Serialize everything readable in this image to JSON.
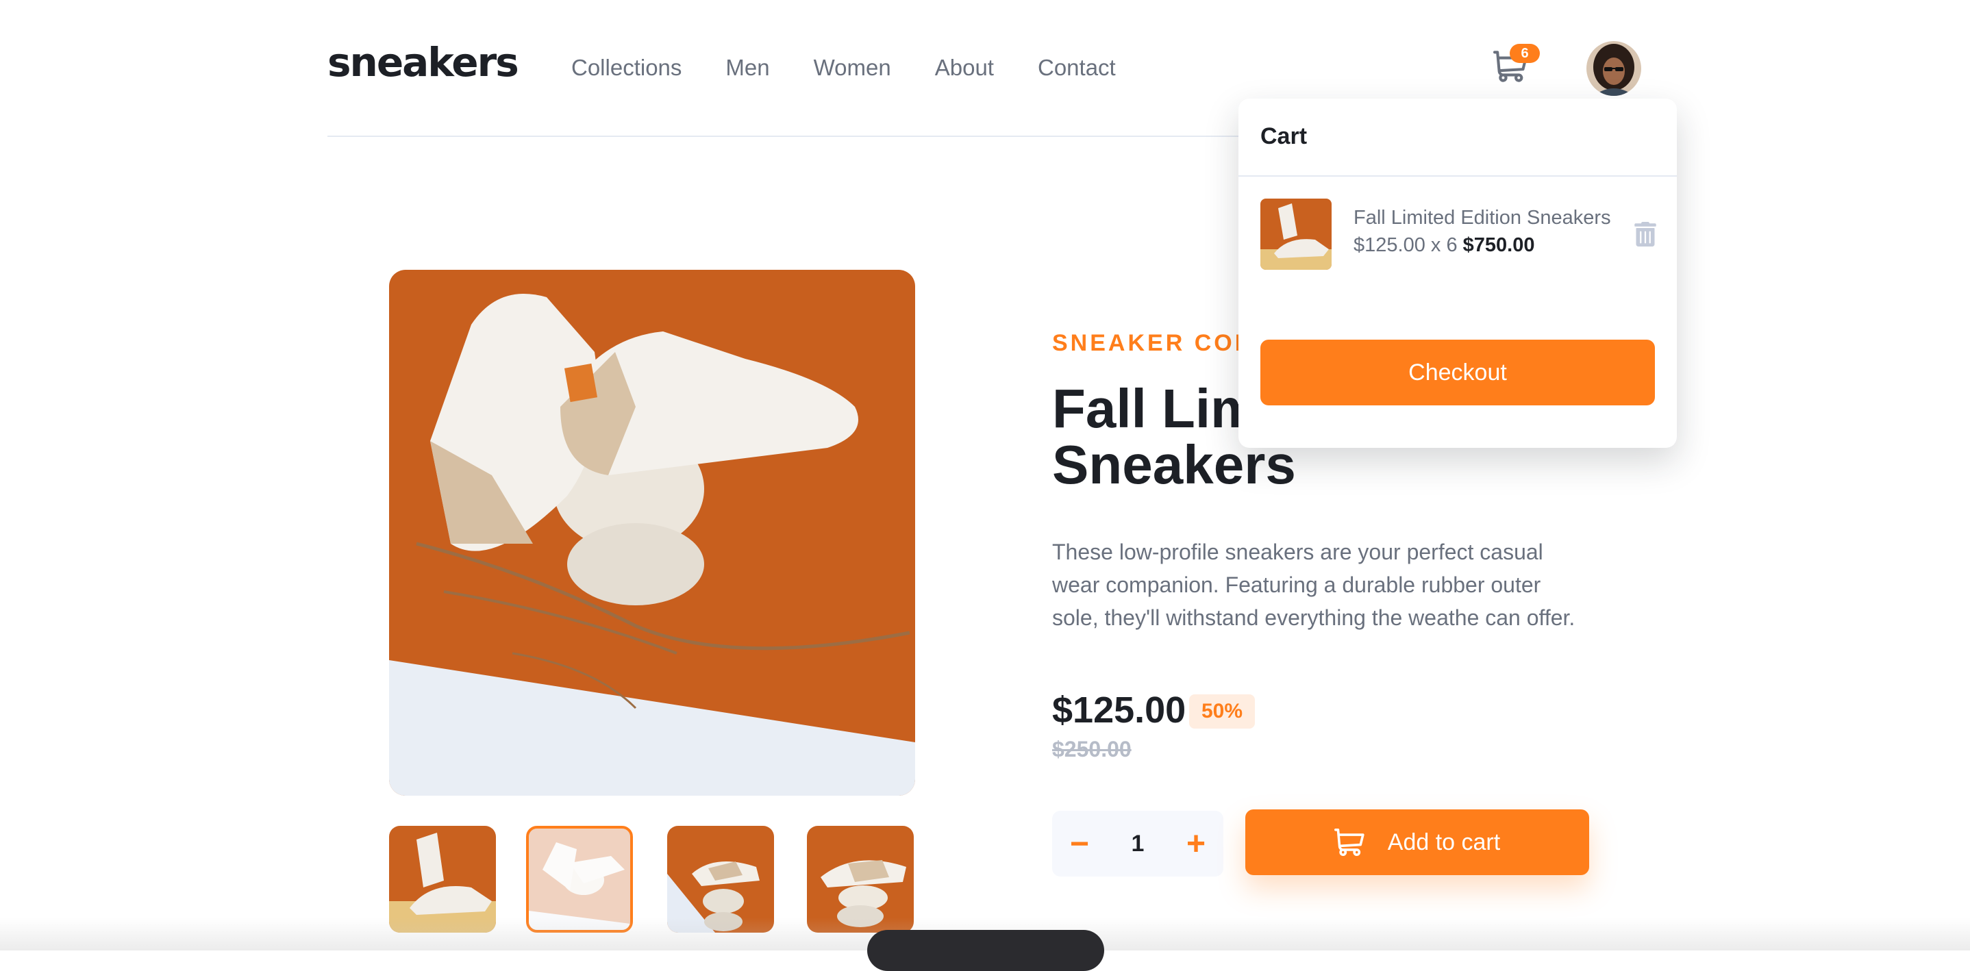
{
  "header": {
    "logo": "sneakers",
    "nav": [
      "Collections",
      "Men",
      "Women",
      "About",
      "Contact"
    ],
    "cart_count": "6",
    "cart_icon": "cart-icon",
    "avatar_icon": "avatar"
  },
  "product": {
    "company": "SNEAKER COMPANY",
    "title_line1": "Fall Limited Edition",
    "title_line2": "Sneakers",
    "description": "These low-profile sneakers are your perfect casual wear companion. Featuring a durable rubber outer sole, they'll withstand everything the weathe can offer.",
    "price": "$125.00",
    "discount": "50%",
    "old_price": "$250.00",
    "quantity": "1",
    "minus": "−",
    "plus": "+",
    "add_to_cart": "Add to cart",
    "selected_thumbnail": 2
  },
  "cart": {
    "title": "Cart",
    "item_name": "Fall Limited Edition Sneakers",
    "item_calc": "$125.00 x 6",
    "item_total": "$750.00",
    "checkout": "Checkout"
  },
  "colors": {
    "accent": "#ff7e1b",
    "accent_pale": "#ffede0",
    "dark": "#1d2026",
    "grey": "#69707d",
    "light_grey": "#b6bcc8"
  }
}
